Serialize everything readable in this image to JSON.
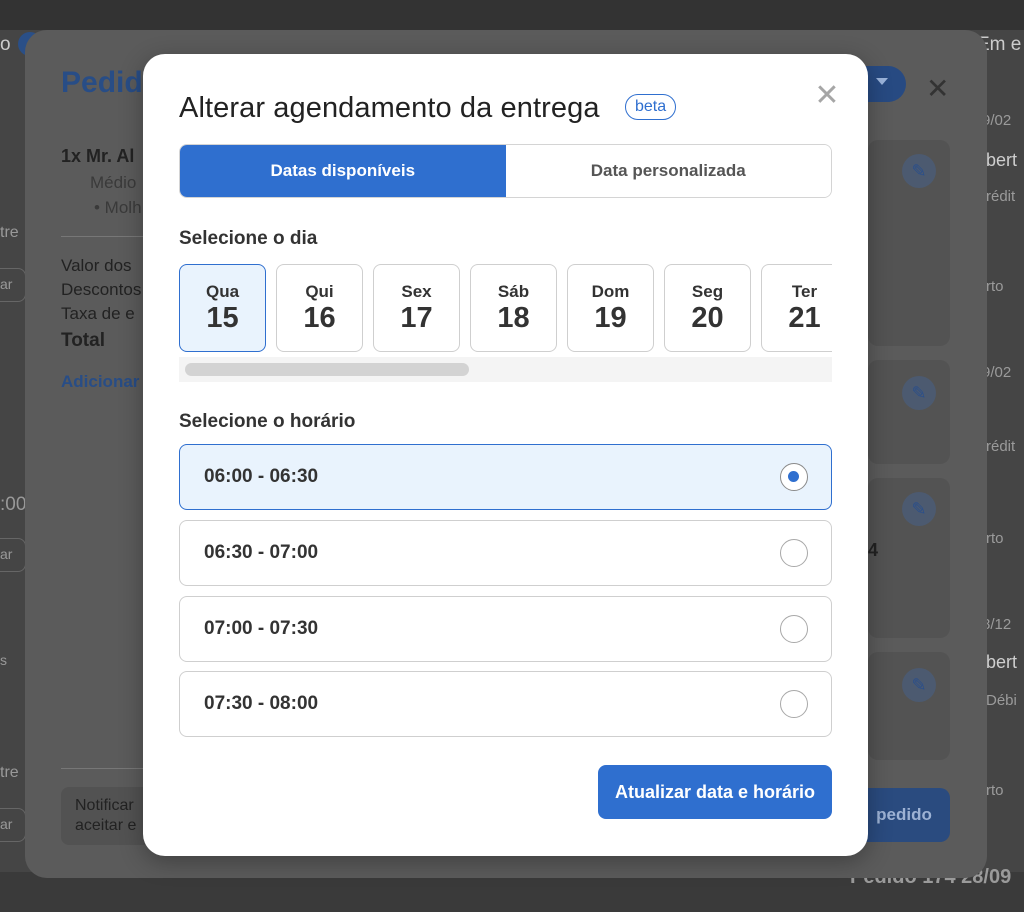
{
  "background": {
    "top_left_text": "o",
    "top_right_text": "Em e",
    "right_column": {
      "texts": [
        "9/02",
        "bert",
        "rédit",
        "rto",
        "9/02",
        "rédit",
        "rto",
        "8/12",
        "bert",
        "Débi",
        "rto"
      ],
      "bottom_text": "Pedido 174 28/09"
    },
    "left_column": {
      "texts": [
        "tre",
        "ar",
        ":00",
        "ar",
        "s",
        "tre",
        "ar"
      ]
    },
    "panel": {
      "title": "Pedido",
      "item_line": "1x Mr. Al",
      "item_size": "Médio",
      "item_extra": "• Molh",
      "summary_values_label": "Valor dos",
      "summary_discounts_label": "Descontos",
      "summary_fee_label": "Taxa de e",
      "summary_total_label": "Total",
      "add_link": "Adicionar",
      "notify_line1": "Notificar",
      "notify_line2": "aceitar e",
      "action_button": "pedido",
      "side_number": "4",
      "close_glyph": "✕",
      "pencil_glyph": "✎"
    }
  },
  "modal": {
    "title": "Alterar agendamento da entrega",
    "badge": "beta",
    "close_glyph": "✕",
    "tabs": [
      {
        "label": "Datas disponíveis",
        "active": true
      },
      {
        "label": "Data personalizada",
        "active": false
      }
    ],
    "day_section_label": "Selecione o dia",
    "days": [
      {
        "name": "Qua",
        "num": "15",
        "selected": true
      },
      {
        "name": "Qui",
        "num": "16",
        "selected": false
      },
      {
        "name": "Sex",
        "num": "17",
        "selected": false
      },
      {
        "name": "Sáb",
        "num": "18",
        "selected": false
      },
      {
        "name": "Dom",
        "num": "19",
        "selected": false
      },
      {
        "name": "Seg",
        "num": "20",
        "selected": false
      },
      {
        "name": "Ter",
        "num": "21",
        "selected": false
      }
    ],
    "time_section_label": "Selecione o horário",
    "slots": [
      {
        "label": "06:00 - 06:30",
        "selected": true
      },
      {
        "label": "06:30 - 07:00",
        "selected": false
      },
      {
        "label": "07:00 - 07:30",
        "selected": false
      },
      {
        "label": "07:30 - 08:00",
        "selected": false
      }
    ],
    "submit_label": "Atualizar data e horário"
  },
  "colors": {
    "primary": "#2f6fcf",
    "selected_bg": "#e9f3fd",
    "overlay_bg": "#454545"
  }
}
